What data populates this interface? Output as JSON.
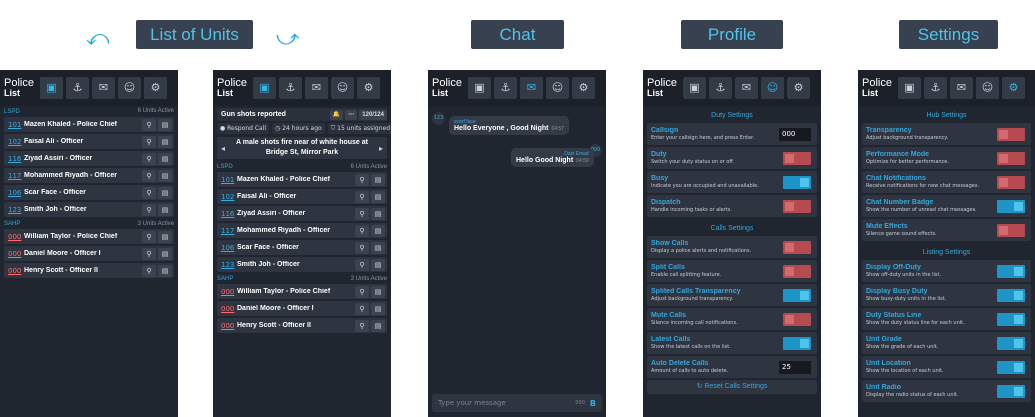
{
  "captions": {
    "list": "List of Units",
    "chat": "Chat",
    "profile": "Profile",
    "settings": "Settings"
  },
  "app": {
    "logo_top": "Police",
    "logo_bottom": "List"
  },
  "tab_icons": [
    "units-icon",
    "dispatch-icon",
    "chat-icon",
    "profile-icon",
    "gear-icon"
  ],
  "panel1": {
    "active_count": "6 Units Active",
    "lspd_label": "LSPD",
    "sahp_label": "SAHP",
    "sahp_count": "3 Units Active",
    "lspd_units": [
      {
        "callsign": "101",
        "name": "Mazen Khaled - Police Chief"
      },
      {
        "callsign": "102",
        "name": "Faisal Ali - Officer"
      },
      {
        "callsign": "116",
        "name": "Ziyad Assiri - Officer"
      },
      {
        "callsign": "117",
        "name": "Mohammed Riyadh - Officer"
      },
      {
        "callsign": "106",
        "name": "Scar Face - Officer"
      },
      {
        "callsign": "123",
        "name": "Smith Joh - Officer"
      }
    ],
    "sahp_units": [
      {
        "callsign": "000",
        "name": "William Taylor - Police Chief"
      },
      {
        "callsign": "000",
        "name": "Daniel Moore - Officer I"
      },
      {
        "callsign": "000",
        "name": "Henry Scott - Officer II"
      }
    ]
  },
  "panel2": {
    "call_title": "Gun shots reported",
    "call_count": "120/124",
    "respond": "Respond Call",
    "time": "24 hours ago",
    "assigned": "15 units assigned",
    "desc_line1": "A male shots fire near of white house at",
    "desc_line2": "Bridge St, Mirror Park",
    "lspd_label": "LSPD",
    "lspd_count": "6 Units Active",
    "sahp_label": "SAHP",
    "sahp_count": "3 Units Active"
  },
  "chat": {
    "msg1_who": "scarf face",
    "msg1_text": "Hello Everyone , Good Night",
    "msg1_time": "04:57",
    "msg1_badge": "123",
    "msg2_who": "Dazi Emad",
    "msg2_text": "Hello Good Night",
    "msg2_time": "04:59",
    "msg2_badge": "000",
    "placeholder": "Type your message",
    "counter": "000",
    "send": "B"
  },
  "profile": {
    "duty_title": "Duty Settings",
    "calls_title": "Calls Settings",
    "callsign_name": "Callsign",
    "callsign_desc": "Enter your callsign here, and press Enter.",
    "callsign_value": "000",
    "duty_name": "Duty",
    "duty_desc": "Switch your duty status on or off.",
    "busy_name": "Busy",
    "busy_desc": "Indicate you are occupied and unavailable.",
    "dispatch_name": "Dispatch",
    "dispatch_desc": "Handle incoming tasks or alerts.",
    "showcalls_name": "Show Calls",
    "showcalls_desc": "Display a police alerts and notifications.",
    "split_name": "Split Calls",
    "split_desc": "Enable call splitting feature.",
    "splittr_name": "Splited Calls Transparency",
    "splittr_desc": "Adjust background transparency.",
    "mute_name": "Mute Calls",
    "mute_desc": "Silence incoming call notifications.",
    "latest_name": "Latest Calls",
    "latest_desc": "Show the latest calls on the list.",
    "autodel_name": "Auto Delete Calls",
    "autodel_desc": "Amount of calls to auto delete.",
    "autodel_value": "25",
    "reset": "Reset Calls Settings"
  },
  "settings": {
    "hub_title": "Hub Settings",
    "listing_title": "Listing Settings",
    "transp_name": "Transparency",
    "transp_desc": "Adjust background transparency.",
    "perf_name": "Performance Mode",
    "perf_desc": "Optimize for better performance.",
    "chatnot_name": "Chat Notifications",
    "chatnot_desc": "Receive notifications for new chat messages.",
    "chatbadge_name": "Chat Number Badge",
    "chatbadge_desc": "Show the number of unread chat messages.",
    "muteeff_name": "Mute Effects",
    "muteeff_desc": "Silence game sound effects.",
    "offduty_name": "Display Off-Duty",
    "offduty_desc": "Show off-duty units in the list.",
    "busyduty_name": "Display Busy Duty",
    "busyduty_desc": "Show busy-duty units in the list.",
    "dutyline_name": "Duty Status Line",
    "dutyline_desc": "Show the duty status line for each unit.",
    "grade_name": "Unit Grade",
    "grade_desc": "Show the grade of each unit.",
    "location_name": "Unit Location",
    "location_desc": "Show the location of each unit.",
    "radio_name": "Unit Radio",
    "radio_desc": "Display the radio status of each unit."
  },
  "colors": {
    "accent": "#35a7dd",
    "panel": "#20262f",
    "off": "#b54a50",
    "on": "#1d96c7"
  }
}
